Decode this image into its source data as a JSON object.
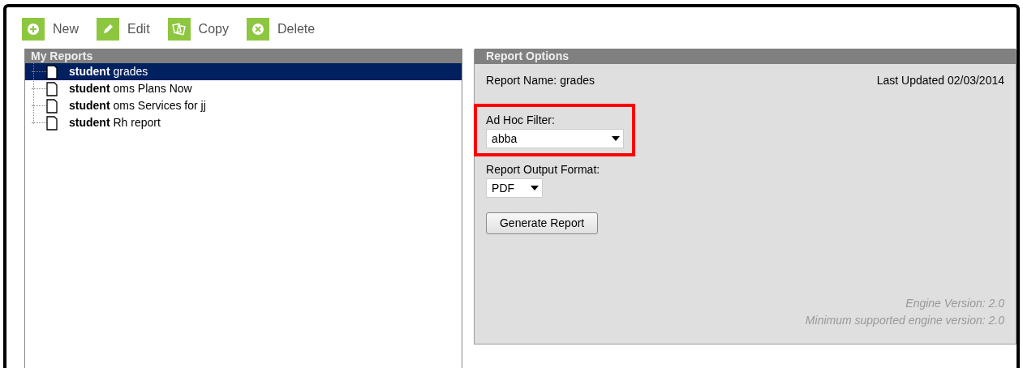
{
  "toolbar": [
    {
      "kind": "new",
      "label": "New"
    },
    {
      "kind": "edit",
      "label": "Edit"
    },
    {
      "kind": "copy",
      "label": "Copy"
    },
    {
      "kind": "delete",
      "label": "Delete"
    }
  ],
  "my_reports": {
    "title": "My Reports",
    "items": [
      {
        "label": "**student** grades",
        "selected": true
      },
      {
        "label": "**student** oms Plans Now",
        "selected": false
      },
      {
        "label": "**student** oms Services for jj",
        "selected": false
      },
      {
        "label": "**student** Rh report",
        "selected": false
      }
    ]
  },
  "report_options": {
    "title": "Report Options",
    "report_name": "Report Name: grades",
    "last_updated": "Last Updated 02/03/2014",
    "ad_hoc_filter": {
      "label": "Ad Hoc Filter:",
      "value": "abba",
      "highlighted": true
    },
    "output_format": {
      "label": "Report Output Format:",
      "value": "PDF"
    },
    "generate_button": "Generate Report",
    "engine_version": "Engine Version: 2.0",
    "min_engine_version": "Minimum supported engine version: 2.0"
  }
}
